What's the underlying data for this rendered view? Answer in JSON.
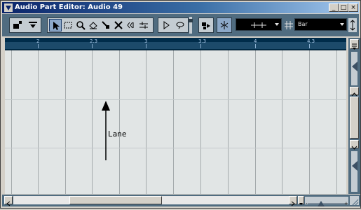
{
  "window": {
    "title": "Audio Part Editor: Audio 49",
    "minimize_glyph": "_",
    "maximize_glyph": "□",
    "close_glyph": "×"
  },
  "toolbar": {
    "buttons": [
      "solo-icon",
      "autoscroll-icon",
      "arrow-tool-icon",
      "range-tool-icon",
      "zoom-tool-icon",
      "eraser-tool-icon",
      "mute-tool-icon",
      "split-tool-icon",
      "glue-tool-icon",
      "scrub-tool-icon",
      "play-icon",
      "loop-icon",
      "snap-icon",
      "snap-to-zero-icon"
    ],
    "snap_value": "",
    "quantize_label": "Bar"
  },
  "ruler": {
    "labels": [
      "2",
      "2.3",
      "3",
      "3.3",
      "4",
      "4.3"
    ]
  },
  "canvas": {
    "annotation": "Lane"
  },
  "colors": {
    "titlebar_start": "#0a246a",
    "toolbar_bg": "#506c80",
    "ruler_bg": "#002c4a",
    "canvas_bg": "#e1e5e5",
    "grid_line": "#a4aaac"
  }
}
